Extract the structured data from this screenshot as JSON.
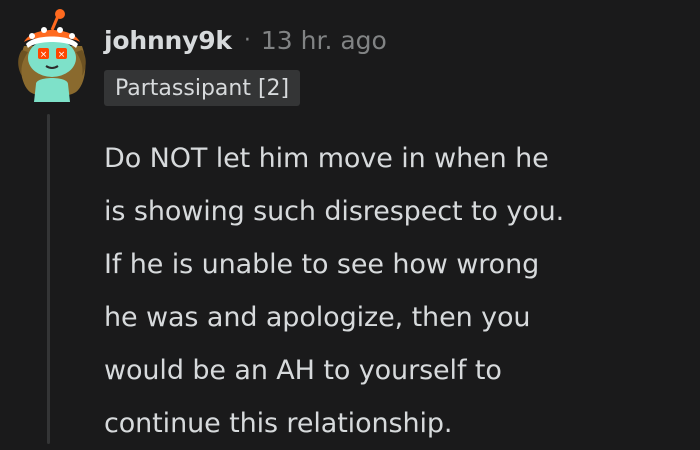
{
  "comment": {
    "author": "johnny9k",
    "separator": "·",
    "timestamp": "13 hr. ago",
    "flair": "Partassipant [2]",
    "avatar_icon": "snoo-avatar-icon",
    "body_lines": [
      "Do NOT let him move in when he",
      "is showing such disrespect to you.",
      "If he is unable to see how wrong",
      "he was and apologize, then you",
      "would be an AH to yourself to",
      "continue this relationship."
    ]
  },
  "colors": {
    "background": "#1a1a1b",
    "text": "#d7dadc",
    "meta": "#818384",
    "flair_bg": "#343536",
    "avatar_face": "#7ee1c9",
    "avatar_hair": "#8a6a2e",
    "avatar_hat": "#ff6a1f"
  }
}
